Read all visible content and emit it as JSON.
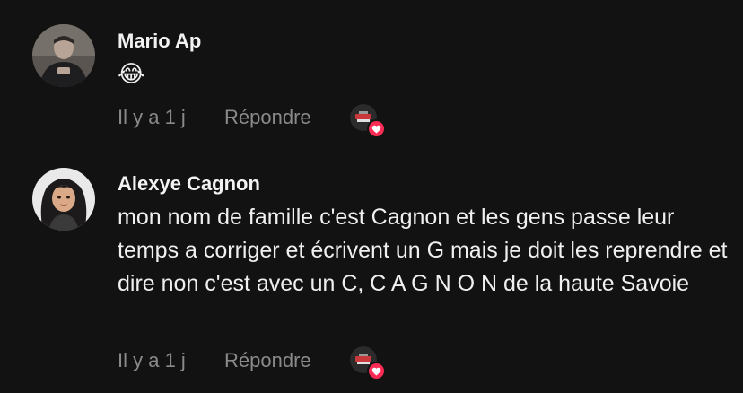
{
  "comments": [
    {
      "username": "Mario Ap",
      "text": "😂",
      "time": "Il y a 1 j",
      "reply_label": "Répondre",
      "liked_by_creator": true
    },
    {
      "username": "Alexye Cagnon",
      "text": "mon nom de famille c'est Cagnon et les gens passe leur temps a corriger et écrivent un G mais je doit les reprendre et dire non c'est avec un C, C A G N O N de la haute Savoie",
      "time": "Il y a 1 j",
      "reply_label": "Répondre",
      "liked_by_creator": true
    }
  ],
  "colors": {
    "background": "#121212",
    "meta_text": "#8a8a8a",
    "heart": "#fe2c55"
  },
  "icons": {
    "creator_like_badge": "heart-icon"
  }
}
